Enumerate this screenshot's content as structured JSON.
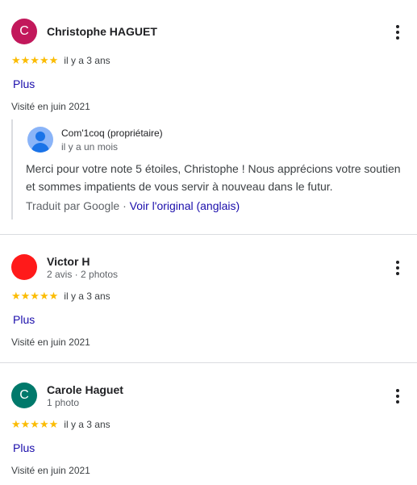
{
  "reviews": [
    {
      "initial": "C",
      "avatar_color": "#c2185b",
      "name": "Christophe HAGUET",
      "subtitle": "",
      "stars": "★★★★★",
      "time": "il y a 3 ans",
      "more_label": "Plus",
      "visited": "Visité en juin 2021",
      "owner_response": {
        "name": "Com'1coq (propriétaire)",
        "time": "il y a un mois",
        "text": "Merci pour votre note 5 étoiles, Christophe ! Nous apprécions votre soutien et sommes impatients de vous servir à nouveau dans le futur.",
        "translated_prefix": "Traduit par Google ·",
        "original_link": "Voir l'original (anglais)"
      }
    },
    {
      "initial": "",
      "avatar_color": "#ff1a1a",
      "name": "Victor H",
      "subtitle": "2 avis · 2 photos",
      "stars": "★★★★★",
      "time": "il y a 3 ans",
      "more_label": "Plus",
      "visited": "Visité en juin 2021"
    },
    {
      "initial": "C",
      "avatar_color": "#00796b",
      "name": "Carole Haguet",
      "subtitle": "1 photo",
      "stars": "★★★★★",
      "time": "il y a 3 ans",
      "more_label": "Plus",
      "visited": "Visité en juin 2021"
    }
  ]
}
